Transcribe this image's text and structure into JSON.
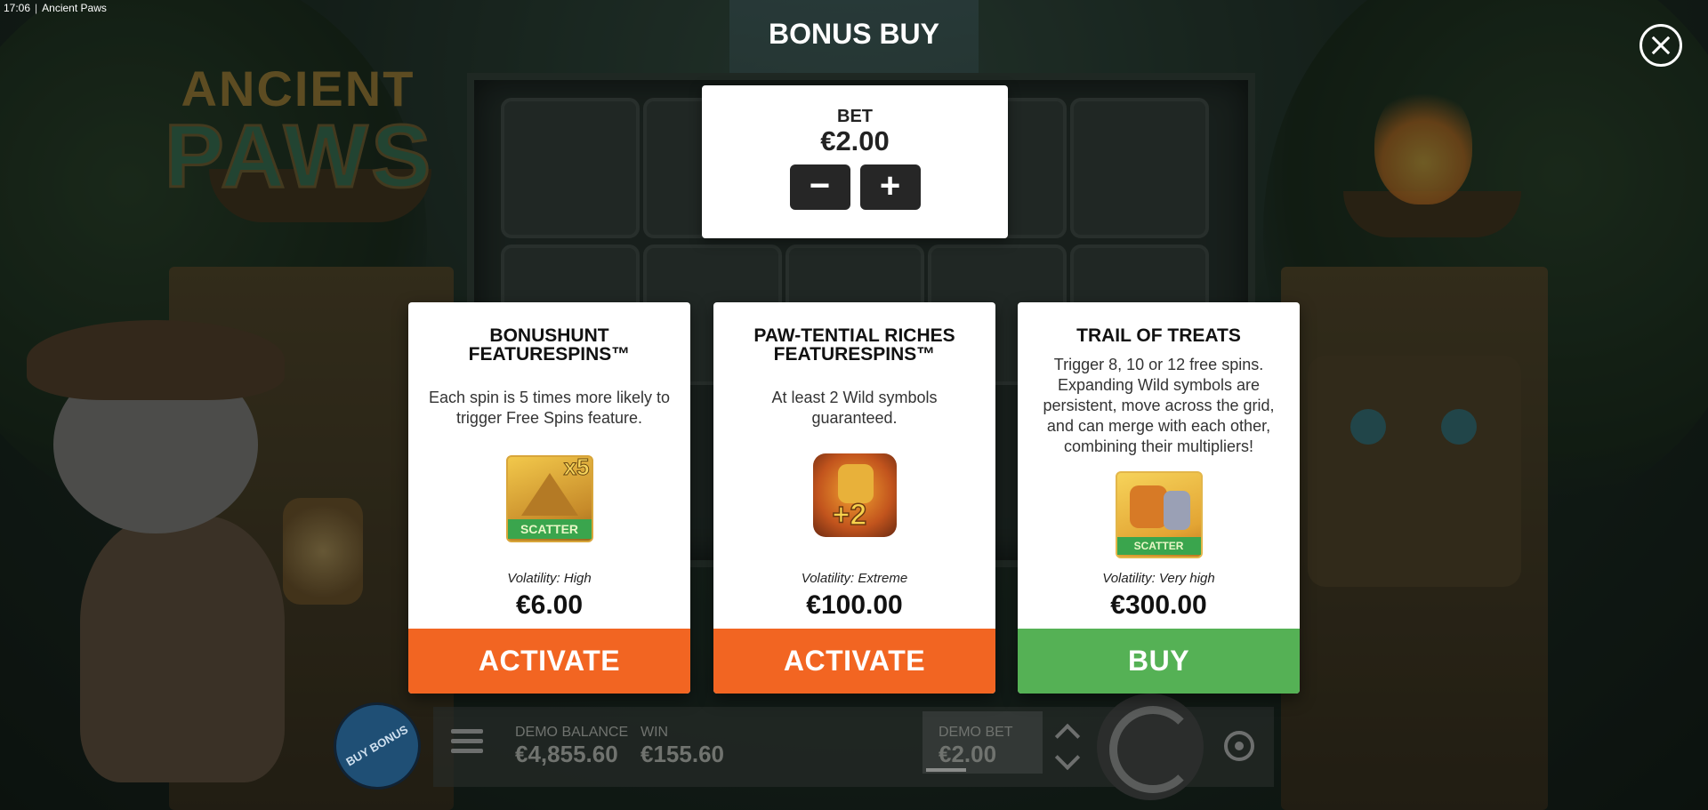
{
  "status_bar": {
    "time": "17:06",
    "app_title": "Ancient Paws"
  },
  "game_logo": {
    "line1": "ANCIENT",
    "line2": "PAWS"
  },
  "dialog": {
    "title": "BONUS BUY",
    "close_icon": "close-icon"
  },
  "bet": {
    "label": "BET",
    "value": "€2.00",
    "decrease_label": "−",
    "increase_label": "+"
  },
  "cards": [
    {
      "title": "BONUSHUNT FEATURESPINS™",
      "description": "Each spin is 5 times more likely to trigger Free Spins feature.",
      "image": {
        "icon": "scatter-x5-icon",
        "badge": "x5",
        "band": "SCATTER"
      },
      "volatility": "Volatility: High",
      "price": "€6.00",
      "button": "ACTIVATE",
      "button_color": "#f26522"
    },
    {
      "title": "PAW-TENTIAL RICHES FEATURESPINS™",
      "description": "At least 2 Wild symbols guaranteed.",
      "image": {
        "icon": "wild-plus2-icon",
        "badge": "+2"
      },
      "volatility": "Volatility: Extreme",
      "price": "€100.00",
      "button": "ACTIVATE",
      "button_color": "#f26522"
    },
    {
      "title": "TRAIL OF TREATS",
      "description": "Trigger 8, 10 or 12 free spins. Expanding Wild symbols are persistent, move across the grid, and can merge with each other, combining their multipliers!",
      "image": {
        "icon": "wild-scatter-icon",
        "band": "SCATTER"
      },
      "volatility": "Volatility: Very high",
      "price": "€300.00",
      "button": "BUY",
      "button_color": "#55b155"
    }
  ],
  "bottom_bar": {
    "buy_bonus": "BUY BONUS",
    "demo_balance_label": "DEMO BALANCE",
    "demo_balance_value": "€4,855.60",
    "win_label": "WIN",
    "win_value": "€155.60",
    "demo_bet_label": "DEMO BET",
    "demo_bet_value": "€2.00"
  }
}
